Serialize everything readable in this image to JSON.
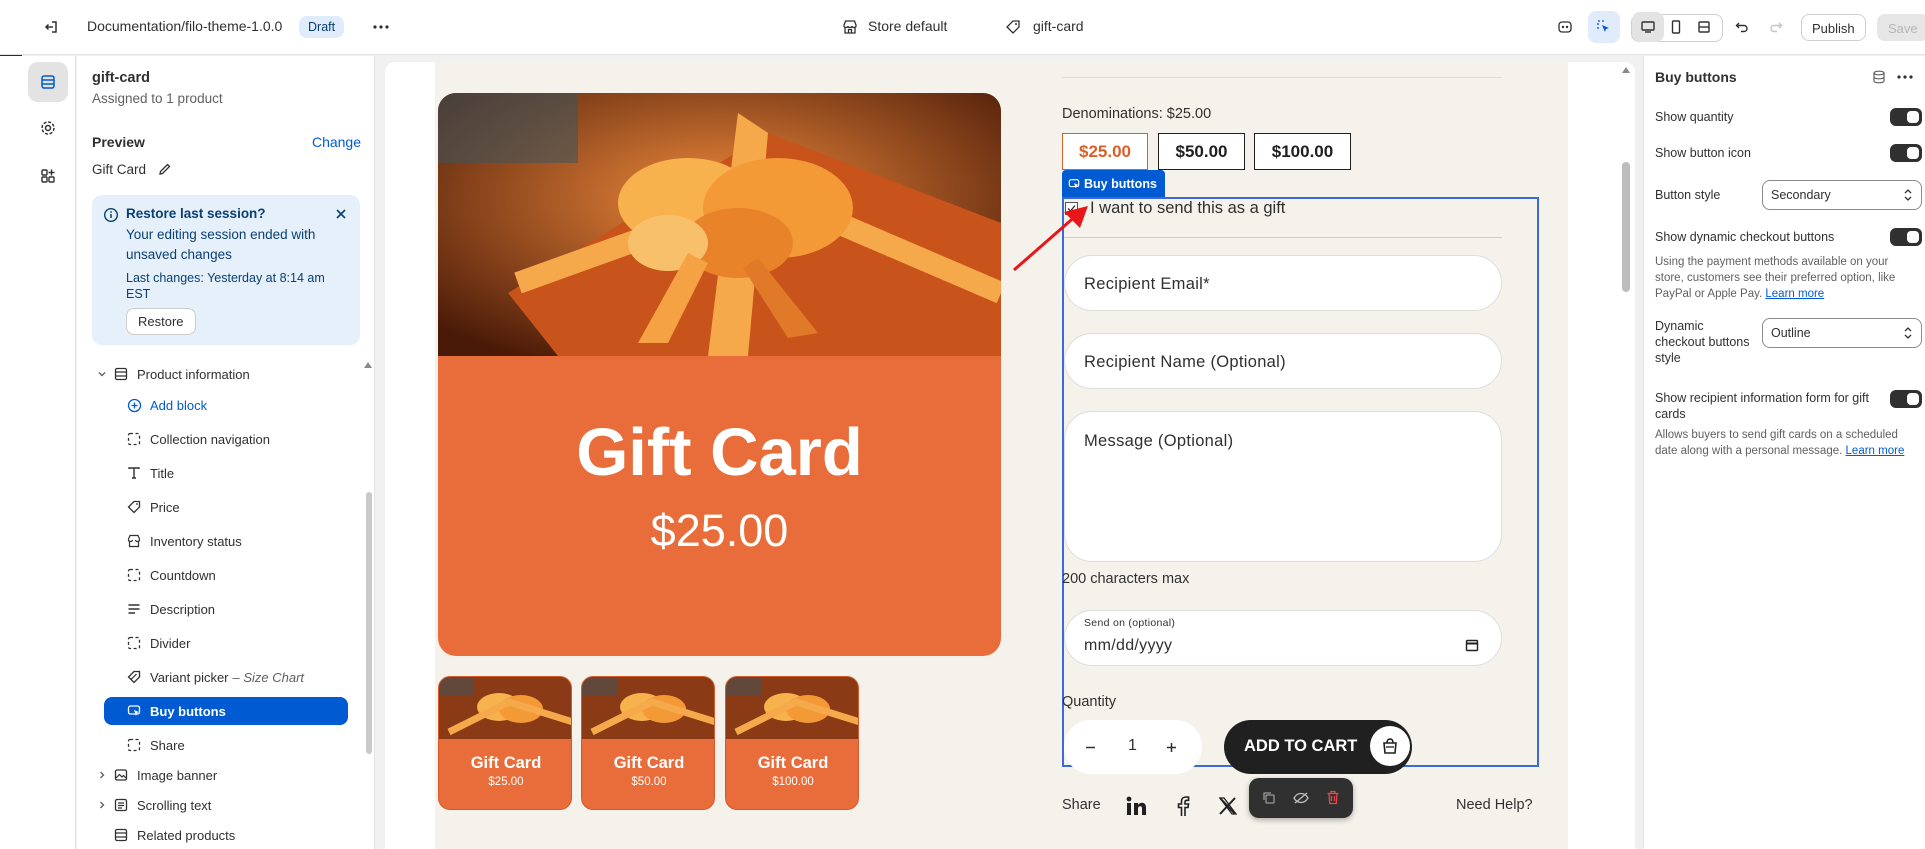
{
  "topbar": {
    "theme_name": "Documentation/filo-theme-1.0.0",
    "badge": "Draft",
    "store": "Store default",
    "template": "gift-card",
    "publish_label": "Publish",
    "save_label": "Save"
  },
  "sidebar": {
    "template_title": "gift-card",
    "assigned": "Assigned to 1 product",
    "preview_label": "Preview",
    "change_label": "Change",
    "preview_item": "Gift Card",
    "restore_banner": {
      "title": "Restore last session?",
      "body": "Your editing session ended with unsaved changes",
      "last_changes": "Last changes: Yesterday at 8:14 am EST",
      "button": "Restore"
    },
    "section_title": "Product information",
    "items": [
      {
        "label": "Add block",
        "icon": "plus-circle-icon"
      },
      {
        "label": "Collection navigation",
        "icon": "dashed-square-icon"
      },
      {
        "label": "Title",
        "icon": "text-icon"
      },
      {
        "label": "Price",
        "icon": "tag-icon"
      },
      {
        "label": "Inventory status",
        "icon": "store-icon"
      },
      {
        "label": "Countdown",
        "icon": "dashed-square-icon"
      },
      {
        "label": "Description",
        "icon": "lines-icon"
      },
      {
        "label": "Divider",
        "icon": "dashed-square-icon"
      },
      {
        "label": "Variant picker",
        "suffix": "– Size Chart",
        "icon": "variant-icon"
      },
      {
        "label": "Buy buttons",
        "icon": "cart-click-icon"
      },
      {
        "label": "Share",
        "icon": "dashed-square-icon"
      }
    ],
    "sections": [
      "Image banner",
      "Scrolling text",
      "Related products"
    ]
  },
  "preview": {
    "hero_title": "Gift Card",
    "hero_price": "$25.00",
    "thumbs": [
      {
        "title": "Gift Card",
        "price": "$25.00"
      },
      {
        "title": "Gift Card",
        "price": "$50.00"
      },
      {
        "title": "Gift Card",
        "price": "$100.00"
      }
    ],
    "denominations_label": "Denominations: $25.00",
    "denominations": [
      "$25.00",
      "$50.00",
      "$100.00"
    ],
    "selection_tag": "Buy buttons",
    "gift_checkbox": "I want to send this as a gift",
    "recipient_email": "Recipient Email*",
    "recipient_name": "Recipient Name (Optional)",
    "message": "Message (Optional)",
    "chars_max": "200 characters max",
    "send_on_label": "Send on (optional)",
    "send_on_value": "mm/dd/yyyy",
    "quantity_label": "Quantity",
    "quantity_value": "1",
    "add_to_cart": "ADD TO CART",
    "share_label": "Share",
    "need_help": "Need Help?"
  },
  "settings": {
    "title": "Buy buttons",
    "show_quantity": "Show quantity",
    "show_button_icon": "Show button icon",
    "button_style_label": "Button style",
    "button_style_value": "Secondary",
    "dynamic_checkout": "Show dynamic checkout buttons",
    "dynamic_help": "Using the payment methods available on your store, customers see their preferred option, like PayPal or Apple Pay.",
    "learn_more": "Learn more",
    "dynamic_style_label": "Dynamic checkout buttons style",
    "dynamic_style_value": "Outline",
    "recipient_form": "Show recipient information form for gift cards",
    "recipient_help": "Allows buyers to send gift cards on a scheduled date along with a personal message.",
    "toggles": {
      "show_quantity": true,
      "show_button_icon": true,
      "dynamic_checkout": true,
      "recipient_form": true
    }
  },
  "colors": {
    "accent": "#005bd3",
    "brand_orange": "#e86d3a",
    "selection": "#3b6ad8"
  }
}
